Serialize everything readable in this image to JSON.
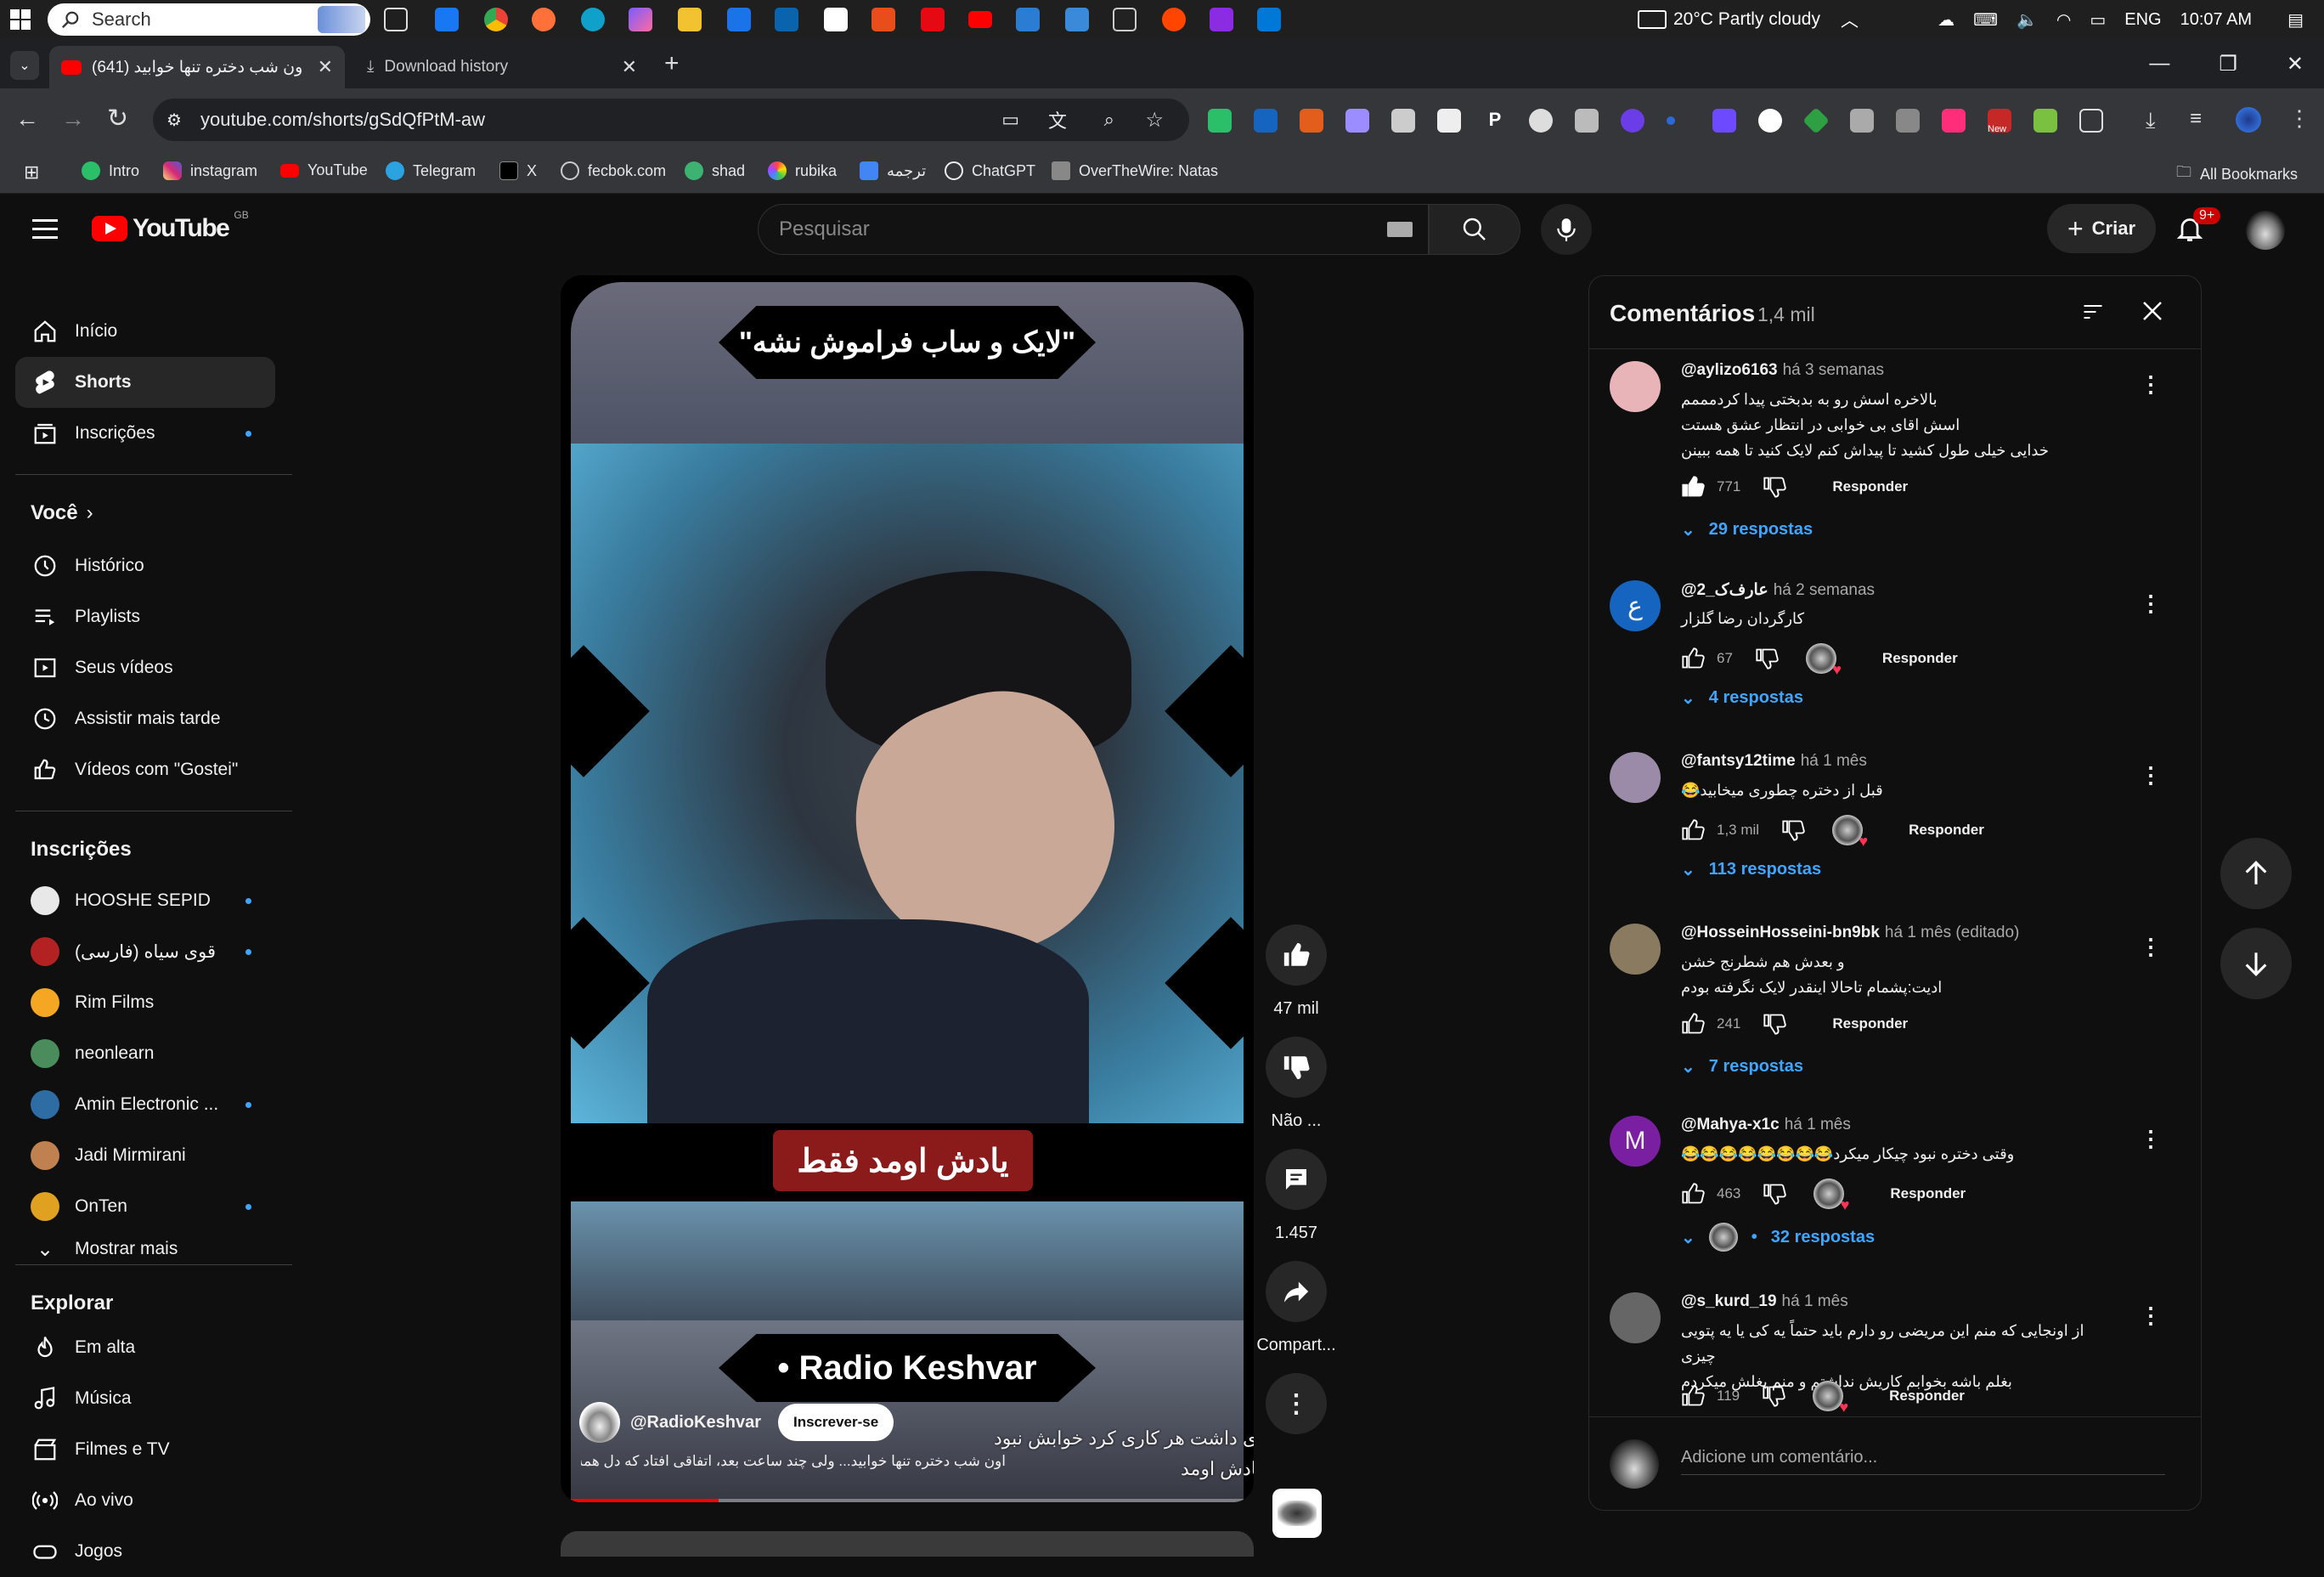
{
  "taskbar": {
    "search_placeholder": "Search",
    "weather": "20°C  Partly cloudy",
    "language": "ENG",
    "time": "10:07 AM"
  },
  "browser": {
    "tabs": [
      {
        "label": "(641) اون شب دختره تنها خوابید...",
        "active": true
      },
      {
        "label": "Download history",
        "active": false
      }
    ],
    "url": "youtube.com/shorts/gSdQfPtM-aw",
    "bookmarks": [
      "Intro",
      "instagram",
      "YouTube",
      "Telegram",
      "X",
      "fecbok.com",
      "shad",
      "rubika",
      "ترجمه",
      "ChatGPT",
      "OverTheWire: Natas"
    ],
    "all_bookmarks": "All Bookmarks",
    "ext_new_badge": "New"
  },
  "youtube": {
    "logo": "YouTube",
    "region": "GB",
    "search_placeholder": "Pesquisar",
    "create_label": "Criar",
    "notif_badge": "9+"
  },
  "sidebar": {
    "main": [
      {
        "label": "Início",
        "icon": "home-icon"
      },
      {
        "label": "Shorts",
        "icon": "shorts-icon"
      },
      {
        "label": "Inscrições",
        "icon": "subscriptions-icon"
      }
    ],
    "you_heading": "Você",
    "you": [
      {
        "label": "Histórico",
        "icon": "history-icon"
      },
      {
        "label": "Playlists",
        "icon": "playlists-icon"
      },
      {
        "label": "Seus vídeos",
        "icon": "your-videos-icon"
      },
      {
        "label": "Assistir mais tarde",
        "icon": "watch-later-icon"
      },
      {
        "label": "Vídeos com \"Gostei\"",
        "icon": "liked-icon"
      }
    ],
    "subs_heading": "Inscrições",
    "subs": [
      {
        "label": "HOOSHE SEPID",
        "color": "#e8e8e8",
        "dot": true
      },
      {
        "label": "قوی سیاه (فارسی)",
        "color": "#b22222",
        "dot": true
      },
      {
        "label": "Rim Films",
        "color": "#f5a623",
        "dot": false
      },
      {
        "label": "neonlearn",
        "color": "#4a8c5c",
        "dot": false
      },
      {
        "label": "Amin Electronic ...",
        "color": "#2e6da4",
        "dot": true
      },
      {
        "label": "Jadi Mirmirani",
        "color": "#c08050",
        "dot": false
      },
      {
        "label": "OnTen",
        "color": "#e0a020",
        "dot": true
      }
    ],
    "show_more": "Mostrar mais",
    "explore_heading": "Explorar",
    "explore": [
      {
        "label": "Em alta",
        "icon": "trending-icon"
      },
      {
        "label": "Música",
        "icon": "music-icon"
      },
      {
        "label": "Filmes e TV",
        "icon": "movies-icon"
      },
      {
        "label": "Ao vivo",
        "icon": "live-icon"
      },
      {
        "label": "Jogos",
        "icon": "gaming-icon"
      }
    ]
  },
  "short": {
    "top_banner": "\"لایک و ساب فراموش نشه\"",
    "caption": "یادش اومد فقط",
    "brand": "• Radio Keshvar",
    "channel": "@RadioKeshvar",
    "subscribe": "Inscrever-se",
    "description": "اون شب دختره تنها خوابید... ولی چند ساعت بعد، اتفاقی افتاد که دل همه رو نرم کرد! 🫣🍜",
    "overlay_line1": "ی داشت هر کاری کرد خوابش نبود",
    "overlay_line2": "یادش اومد",
    "progress": 0.22,
    "actions": {
      "likes": "47 mil",
      "dislike": "Não ...",
      "comments": "1.457",
      "share": "Compart..."
    }
  },
  "comments": {
    "title": "Comentários",
    "count": "1,4 mil",
    "reply_label": "Responder",
    "add_placeholder": "Adicione um comentário...",
    "items": [
      {
        "author": "@aylizo6163",
        "time": "há 3 semanas",
        "text": [
          "بالاخره اسش رو به بدبختی پیدا کردمممم",
          "اسش اقای بی خوابی در انتظار عشق هستت",
          "خدایی خیلی طول کشید تا پیداش کنم لایک کنید تا همه ببینن"
        ],
        "likes": "771",
        "replies": "29 respostas",
        "avatar_color": "#e8b4b8",
        "avatar_letter": "",
        "hearted": false
      },
      {
        "author": "@عارف‌ک_2",
        "time": "há 2 semanas",
        "text": [
          "کارگردان رضا گلزار"
        ],
        "likes": "67",
        "replies": "4 respostas",
        "avatar_color": "#1565c0",
        "avatar_letter": "ع",
        "hearted": true
      },
      {
        "author": "@fantsy12time",
        "time": "há 1 mês",
        "text": [
          "قبل از دختره چطوری میخابید😂"
        ],
        "likes": "1,3 mil",
        "replies": "113 respostas",
        "avatar_color": "#9b8aa8",
        "avatar_letter": "",
        "hearted": true
      },
      {
        "author": "@HosseinHosseini-bn9bk",
        "time": "há 1 mês (editado)",
        "text": [
          "و بعدش هم شطرنج خشن",
          "ادیت:پشمام تاحالا اینقدر لایک نگرفته بودم"
        ],
        "likes": "241",
        "replies": "7 respostas",
        "avatar_color": "#8a7a60",
        "avatar_letter": "",
        "hearted": false
      },
      {
        "author": "@Mahya-x1c",
        "time": "há 1 mês",
        "text": [
          "وقتی دختره نبود چیکار میکرد😂😂😂😂😂😂😂😂"
        ],
        "likes": "463",
        "replies": "32 respostas",
        "avatar_color": "#7b1fa2",
        "avatar_letter": "M",
        "hearted": true
      },
      {
        "author": "@s_kurd_19",
        "time": "há 1 mês",
        "text": [
          "از اونجایی که منم این مریضی رو دارم باید حتماً یه کی یا یه پتویی چیزی",
          "بغلم باشه بخوابم کاریش نداشتم و منم بغلش میکردم"
        ],
        "likes": "119",
        "replies": "",
        "avatar_color": "#666",
        "avatar_letter": "",
        "hearted": true
      }
    ]
  }
}
